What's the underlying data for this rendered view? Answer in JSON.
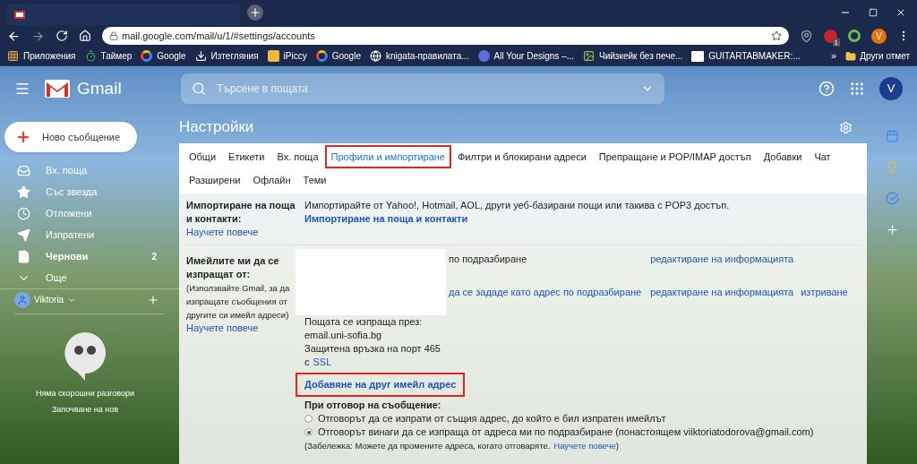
{
  "browser": {
    "address": "mail.google.com/mail/u/1/#settings/accounts",
    "extension_badge": "1",
    "profile_initial": "V",
    "bookmarks": [
      {
        "label": "Приложения",
        "kind": "apps"
      },
      {
        "label": "Таймер",
        "kind": "timer"
      },
      {
        "label": "Google",
        "kind": "google"
      },
      {
        "label": "Изтегляния",
        "kind": "download"
      },
      {
        "label": "iPiccy",
        "kind": "piccy"
      },
      {
        "label": "Google",
        "kind": "google"
      },
      {
        "label": "knigata-правилата...",
        "kind": "globe"
      },
      {
        "label": "All Your Designs –...",
        "kind": "letter"
      },
      {
        "label": "Чийзкейк без пече...",
        "kind": "image"
      },
      {
        "label": "GUITARTABMAKER:...",
        "kind": "tab"
      }
    ],
    "more": "»",
    "other_bookmarks": "Други отмет"
  },
  "header": {
    "logo": "Gmail",
    "search_placeholder": "Търсене в пощата",
    "avatar": "V"
  },
  "sidebar": {
    "compose": "Ново съобщение",
    "items": [
      {
        "label": "Вх. поща",
        "kind": "inbox",
        "bold": false
      },
      {
        "label": "Със звезда",
        "kind": "star",
        "bold": false
      },
      {
        "label": "Отложени",
        "kind": "clock",
        "bold": false
      },
      {
        "label": "Изпратени",
        "kind": "send",
        "bold": false
      },
      {
        "label": "Чернови",
        "kind": "draft",
        "bold": true,
        "count": "2"
      },
      {
        "label": "Още",
        "kind": "more",
        "bold": false
      }
    ],
    "account": "Viktoria",
    "hangouts": {
      "message": "Няма скорошни разговори",
      "action": "Започване на нов"
    }
  },
  "settings": {
    "title": "Настройки",
    "tabs": [
      {
        "label": "Общи",
        "selected": false,
        "highlighted": false
      },
      {
        "label": "Етикети",
        "selected": false,
        "highlighted": false
      },
      {
        "label": "Вх. поща",
        "selected": false,
        "highlighted": false
      },
      {
        "label": "Профили и импортиране",
        "selected": true,
        "highlighted": true
      },
      {
        "label": "Филтри и блокирани адреси",
        "selected": false,
        "highlighted": false
      },
      {
        "label": "Препращане и POP/IMAP достъп",
        "selected": false,
        "highlighted": false
      },
      {
        "label": "Добавки",
        "selected": false,
        "highlighted": false
      },
      {
        "label": "Чат",
        "selected": false,
        "highlighted": false
      },
      {
        "label": "Разширени",
        "selected": false,
        "highlighted": false
      },
      {
        "label": "Офлайн",
        "selected": false,
        "highlighted": false
      },
      {
        "label": "Теми",
        "selected": false,
        "highlighted": false
      }
    ],
    "import": {
      "label": "Импортиране на поща и контакти:",
      "learn_more": "Научете повече",
      "description": "Импортирайте от Yahoo!, Hotmail, AOL, други уеб-базирани пощи или такива с POP3 достъп.",
      "link": "Импортиране на поща и контакти"
    },
    "send_as": {
      "label": "Имейлите ми да се изпращат от:",
      "note": "(Използвайте Gmail, за да изпращате съобщения от другите си имейл адреси)",
      "learn_more": "Научете повече",
      "rows": [
        {
          "status": "по подразбиране",
          "actions": [
            "редактиране на информацията"
          ]
        },
        {
          "status": "да се зададе като адрес по подразбиране",
          "actions": [
            "редактиране на информацията",
            "изтриване"
          ]
        }
      ],
      "server_lines": [
        "Пощата се изпраща през:",
        "email.uni-sofia.bg",
        "Защитена връзка на порт 465"
      ],
      "ssl_prefix": "с",
      "ssl_link": "SSL",
      "add_link": {
        "label": "Добавяне на друг имейл адрес",
        "highlighted": true
      },
      "reply_label": "При отговор на съобщение:",
      "reply_options": [
        {
          "label": "Отговорът да се изпрати от същия адрес, до който е бил изпратен имейлът",
          "selected": false
        },
        {
          "label": "Отговорът винаги да се изпраща от адреса ми по подразбиране (понастоящем viiktoriatodorova@gmail.com)",
          "selected": true
        }
      ],
      "note_text": "(Забележка: Можете да промените адреса, когато отговаряте.",
      "note_link": "Научете повече",
      "note_end": ")"
    }
  }
}
